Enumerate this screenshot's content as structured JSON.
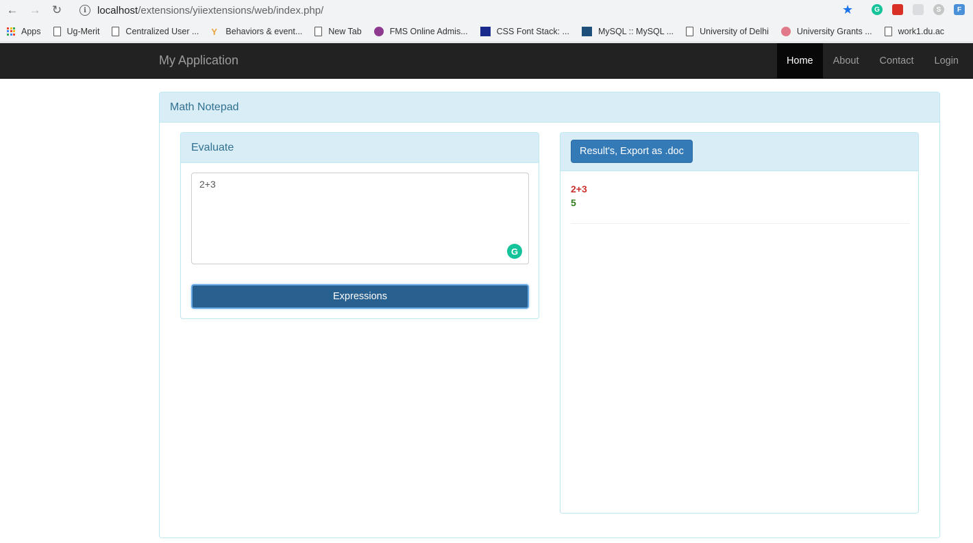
{
  "browser": {
    "url_host": "localhost",
    "url_path": "/extensions/yiiextensions/web/index.php/",
    "bookmarks": [
      "Apps",
      "Ug-Merit",
      "Centralized User ...",
      "Behaviors & event...",
      "New Tab",
      "FMS Online Admis...",
      "CSS Font Stack: ...",
      "MySQL :: MySQL ...",
      "University of Delhi",
      "University Grants ...",
      "work1.du.ac"
    ]
  },
  "navbar": {
    "brand": "My Application",
    "links": [
      "Home",
      "About",
      "Contact",
      "Login"
    ],
    "active": "Home"
  },
  "main": {
    "panel_title": "Math Notepad",
    "evaluate": {
      "title": "Evaluate",
      "input_value": "2+3",
      "button_label": "Expressions"
    },
    "results": {
      "export_button_label": "Result's, Export as .doc",
      "expression": "2+3",
      "value": "5"
    }
  },
  "colors": {
    "navbar_bg": "#222222",
    "panel_heading_bg": "#d9edf7",
    "panel_border": "#bce8f1",
    "primary_button": "#337ab7",
    "expression_color": "#c9302c",
    "result_color": "#2e7d1a"
  }
}
